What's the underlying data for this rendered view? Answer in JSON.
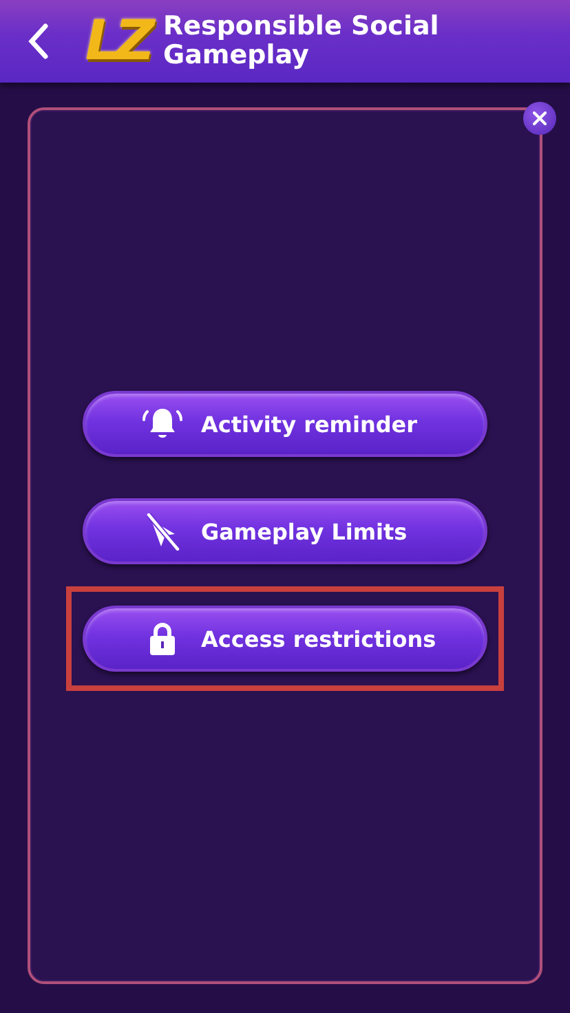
{
  "header": {
    "logo_text": "LZ",
    "title": "Responsible Social Gameplay"
  },
  "options": [
    {
      "label": "Activity reminder",
      "kind": "bell",
      "selected": false
    },
    {
      "label": "Gameplay Limits",
      "kind": "no-cursor",
      "selected": false
    },
    {
      "label": "Access restrictions",
      "kind": "lock",
      "selected": true
    }
  ]
}
